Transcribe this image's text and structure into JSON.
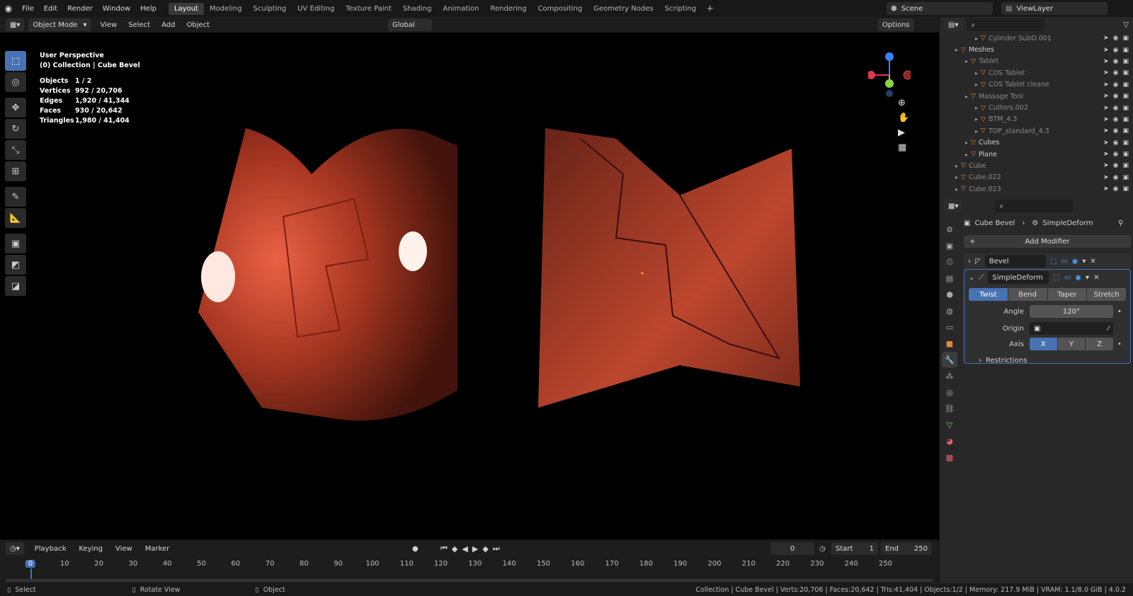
{
  "menus": [
    "File",
    "Edit",
    "Render",
    "Window",
    "Help"
  ],
  "workspaces": [
    "Layout",
    "Modeling",
    "Sculpting",
    "UV Editing",
    "Texture Paint",
    "Shading",
    "Animation",
    "Rendering",
    "Compositing",
    "Geometry Nodes",
    "Scripting"
  ],
  "scene": "Scene",
  "view_layer": "ViewLayer",
  "viewport_header": {
    "mode": "Object Mode",
    "menus": [
      "View",
      "Select",
      "Add",
      "Object"
    ],
    "orientation": "Global",
    "options": "Options"
  },
  "overlay_text": {
    "perspective": "User Perspective",
    "collection": "(0) Collection | Cube Bevel",
    "stats": [
      {
        "label": "Objects",
        "value": "1 / 2"
      },
      {
        "label": "Vertices",
        "value": "992 / 20,706"
      },
      {
        "label": "Edges",
        "value": "1,920 / 41,344"
      },
      {
        "label": "Faces",
        "value": "930 / 20,642"
      },
      {
        "label": "Triangles",
        "value": "1,980 / 41,404"
      }
    ]
  },
  "outliner": [
    {
      "label": "Cylinder SubD.001",
      "indent": 3,
      "dim": true
    },
    {
      "label": "Meshes",
      "indent": 1,
      "dim": false
    },
    {
      "label": "Tablet",
      "indent": 2,
      "dim": true
    },
    {
      "label": "COS Tablet",
      "indent": 3,
      "dim": true
    },
    {
      "label": "COS Tablet cleane",
      "indent": 3,
      "dim": true
    },
    {
      "label": "Massage Tool",
      "indent": 2,
      "dim": true
    },
    {
      "label": "Cutters.002",
      "indent": 3,
      "dim": true
    },
    {
      "label": "BTM_4.3",
      "indent": 3,
      "dim": true
    },
    {
      "label": "TOP_standard_4.3",
      "indent": 3,
      "dim": true
    },
    {
      "label": "Cubes",
      "indent": 2,
      "dim": false
    },
    {
      "label": "Plane",
      "indent": 2,
      "dim": false
    },
    {
      "label": "Cube",
      "indent": 1,
      "dim": true
    },
    {
      "label": "Cube.022",
      "indent": 1,
      "dim": true
    },
    {
      "label": "Cube.023",
      "indent": 1,
      "dim": true
    }
  ],
  "properties": {
    "object": "Cube Bevel",
    "modifier_path": "SimpleDeform",
    "add_modifier": "Add Modifier",
    "bevel_name": "Bevel",
    "simpledeform_name": "SimpleDeform",
    "deform_modes": [
      "Twist",
      "Bend",
      "Taper",
      "Stretch"
    ],
    "active_mode": "Twist",
    "angle_label": "Angle",
    "angle_value": "120°",
    "origin_label": "Origin",
    "axis_label": "Axis",
    "axes": [
      "X",
      "Y",
      "Z"
    ],
    "active_axis": "X",
    "restrictions": "Restrictions"
  },
  "timeline": {
    "menus": [
      "Playback",
      "Keying",
      "View",
      "Marker"
    ],
    "current_frame": "0",
    "start_label": "Start",
    "start": "1",
    "end_label": "End",
    "end": "250",
    "ticks": [
      "0",
      "10",
      "20",
      "30",
      "40",
      "50",
      "60",
      "70",
      "80",
      "90",
      "100",
      "110",
      "120",
      "130",
      "140",
      "150",
      "160",
      "170",
      "180",
      "190",
      "200",
      "210",
      "220",
      "230",
      "240",
      "250"
    ]
  },
  "statusbar": {
    "select": "Select",
    "rotate": "Rotate View",
    "object": "Object",
    "info": "Collection | Cube Bevel | Verts:20,706 | Faces:20,642 | Tris:41,404 | Objects:1/2 | Memory: 217.9 MiB | VRAM: 1.1/8.0 GiB | 4.0.2"
  }
}
